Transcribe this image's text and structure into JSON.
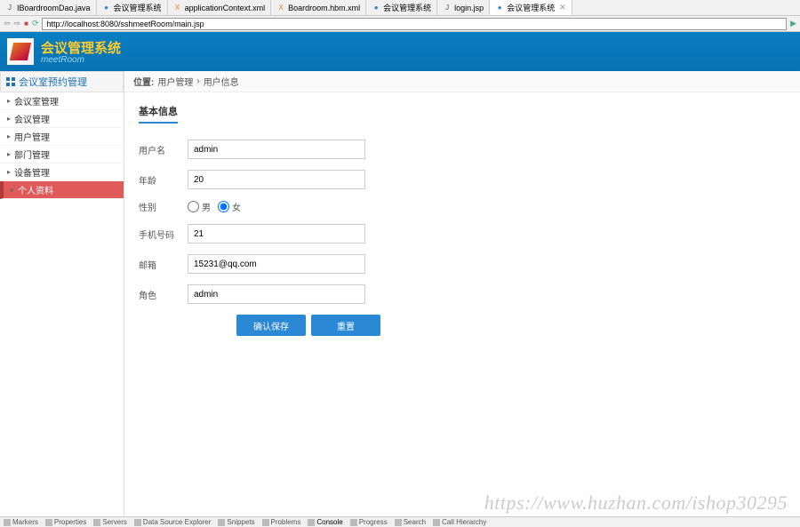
{
  "editor_tabs": [
    {
      "icon": "j",
      "label": "IBoardroomDao.java"
    },
    {
      "icon": "w",
      "label": "会议管理系统"
    },
    {
      "icon": "x",
      "label": "applicationContext.xml"
    },
    {
      "icon": "x",
      "label": "Boardroom.hbm.xml"
    },
    {
      "icon": "w",
      "label": "会议管理系统"
    },
    {
      "icon": "j",
      "label": "login.jsp"
    },
    {
      "icon": "w",
      "label": "会议管理系统"
    }
  ],
  "url": "http://localhost:8080/sshmeetRoom/main.jsp",
  "header": {
    "title": "会议管理系统",
    "subtitle": "meetRoom"
  },
  "sidebar": {
    "header": "会议室预约管理",
    "items": [
      {
        "label": "会议室管理"
      },
      {
        "label": "会议管理"
      },
      {
        "label": "用户管理"
      },
      {
        "label": "部门管理"
      },
      {
        "label": "设备管理"
      },
      {
        "label": "个人资料",
        "active": true
      }
    ]
  },
  "breadcrumb": {
    "prefix": "位置:",
    "part1": "用户管理",
    "sep": "›",
    "part2": "用户信息"
  },
  "section_title": "基本信息",
  "form": {
    "username": {
      "label": "用户名",
      "value": "admin"
    },
    "age": {
      "label": "年龄",
      "value": "20"
    },
    "gender": {
      "label": "性别",
      "male": "男",
      "female": "女"
    },
    "phone": {
      "label": "手机号码",
      "value": "21"
    },
    "email": {
      "label": "邮箱",
      "value": "15231@qq.com"
    },
    "role": {
      "label": "角色",
      "value": "admin"
    }
  },
  "buttons": {
    "submit": "确认保存",
    "reset": "重置"
  },
  "watermark": "https://www.huzhan.com/ishop30295",
  "status": [
    "Markers",
    "Properties",
    "Servers",
    "Data Source Explorer",
    "Snippets",
    "Problems",
    "Console",
    "Progress",
    "Search",
    "Call Hierarchy"
  ]
}
